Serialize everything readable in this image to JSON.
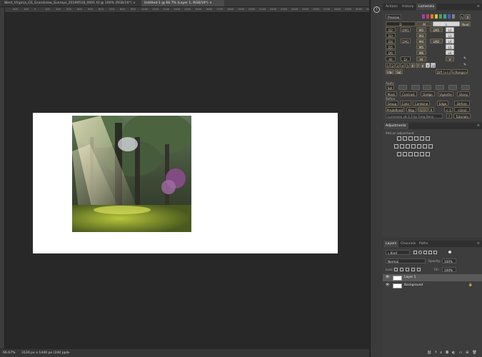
{
  "document_tabs": [
    {
      "label": "West_Virginia_GS_Grandview_Sunrays_20190518_0001.tif @ 100% (RGB/16*) ×"
    },
    {
      "label": "Untitled-1 @ 66.7% (Layer 1, RGB/16*) ×"
    }
  ],
  "ruler_ticks": [
    "200",
    "100",
    "0",
    "100",
    "200",
    "300",
    "400",
    "500",
    "600",
    "700",
    "800",
    "900",
    "1000",
    "1100",
    "1200",
    "1300",
    "1400",
    "1500",
    "1600",
    "1700",
    "1800",
    "1900",
    "2000",
    "2100",
    "2200",
    "2300",
    "2400",
    "2500",
    "2600",
    "2700",
    "2800",
    "2900",
    "3000",
    "3100",
    "3200"
  ],
  "status": {
    "zoom": "66.67%",
    "doc_size": "3120 px x 1440 px (240 ppi)",
    "arrow": ">"
  },
  "panel_tabs_top": [
    "Actions",
    "History",
    "Lumenzia"
  ],
  "lumenzia": {
    "preview": "Preview",
    "x": "X",
    "next": "Next",
    "zone_rows": [
      [
        "D",
        "M",
        "L"
      ],
      [
        "D2",
        "DM1",
        "M2",
        "LM1",
        "L2"
      ],
      [
        "D3",
        "M3",
        "L3"
      ],
      [
        "D4",
        "DM2",
        "M4",
        "LM2",
        "L4"
      ],
      [
        "D5",
        "M5",
        "L5"
      ],
      [
        "D6",
        "M6",
        "L6"
      ]
    ],
    "all_row": [
      "All",
      "Dr",
      "HI",
      "V"
    ],
    "numbers": [
      "1",
      "2",
      "3",
      "4",
      "5",
      "6",
      "7",
      "8",
      "9",
      "10"
    ],
    "vibr": "Vibr",
    "sat": "Sat",
    "diff": "Diff (+/-)",
    "range": "<Range>",
    "apply_label": "Apply",
    "sel": "Sel",
    "row_mask": [
      "Mask",
      "Contrast",
      "Dodge",
      "Vignette",
      "Sharp"
    ],
    "refine_label": "Refine",
    "row_group": [
      "Group",
      "Color",
      "Combine",
      "Edge",
      "Before"
    ],
    "row_predefined": [
      "Predefined",
      "Map",
      "Split",
      "R",
      "<-1",
      "<Unct"
    ],
    "version": "Lumenzia v8.3.3 by Greg Benz",
    "question": "?",
    "tutorials": "Tutorials",
    "swatch_colors": [
      "#a040b0",
      "#c04060",
      "#d08030",
      "#d0c040",
      "#50a050",
      "#40a0a0",
      "#4060c0",
      "#808080"
    ]
  },
  "adjustments": {
    "tab": "Adjustments",
    "add_label": "Add an adjustment"
  },
  "layers_panel": {
    "tabs": [
      "Layers",
      "Channels",
      "Paths"
    ],
    "kind": "Kind",
    "blend_mode": "Normal",
    "opacity_label": "Opacity:",
    "opacity_value": "100%",
    "lock_label": "Lock:",
    "fill_label": "Fill:",
    "fill_value": "100%",
    "layers": [
      {
        "name": "Layer 1",
        "selected": true
      },
      {
        "name": "Background",
        "selected": false,
        "locked": true
      }
    ]
  }
}
